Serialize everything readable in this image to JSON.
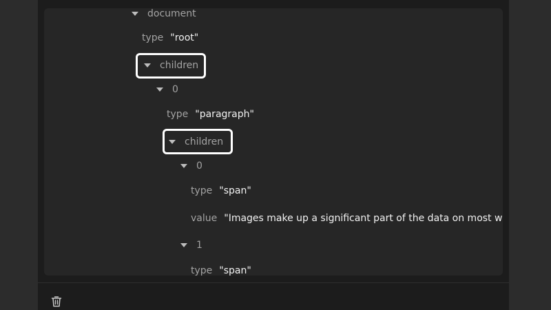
{
  "tree": {
    "root_label": "document",
    "type_key": "type",
    "root_type": "\"root\"",
    "children_key": "children",
    "index_0": "0",
    "paragraph_type": "\"paragraph\"",
    "span0_type": "\"span\"",
    "value_key": "value",
    "span0_value": "\"Images make up a significant part of the data on most w",
    "index_1": "1",
    "span1_type": "\"span\""
  },
  "footer": {
    "delete_icon": "trash-icon"
  }
}
